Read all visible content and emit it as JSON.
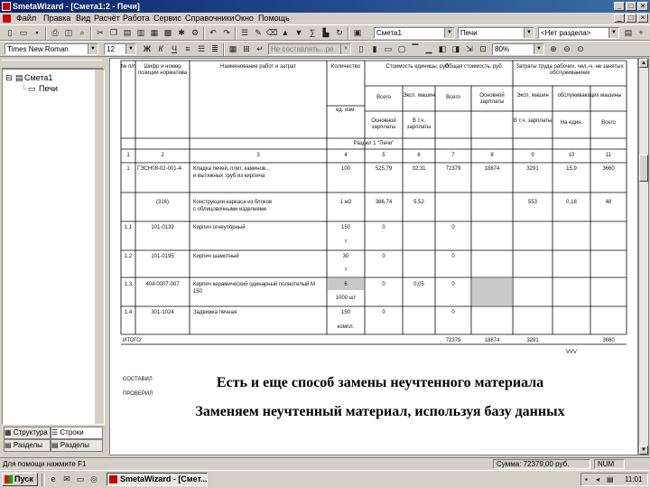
{
  "window": {
    "title": "SmetaWizard - [Смета1:2 - Печи]",
    "controls": [
      "_",
      "□",
      "×"
    ]
  },
  "menu": {
    "items": [
      "Файл",
      "Правка",
      "Вид",
      "Расчёт",
      "Работа",
      "Сервис",
      "Справочники",
      "Окно",
      "Помощь"
    ],
    "mdi_controls": [
      "_",
      "□",
      "×"
    ]
  },
  "toolbar1": {
    "estimate_combo": "Смета1",
    "section_combo": "Печи",
    "division_combo": "<Нет раздела>"
  },
  "toolbar2": {
    "font_combo": "Times New Roman",
    "size_combo": "12",
    "bold": "Ж",
    "italic": "К",
    "underline": "Ч",
    "style_combo": "Не составлять...ре",
    "zoom_combo": "80%"
  },
  "tree": {
    "root": "Смета1",
    "child": "Печи"
  },
  "panel_tabs": [
    "Структура",
    "Строки",
    "Разделы",
    "Разделы"
  ],
  "table": {
    "headers": {
      "num": "№ п/п",
      "code": "Шифр и номер позиции норматива",
      "name": "Наименование работ и затрат",
      "qty": "Количество",
      "unit_cost": "Стоимость единицы, руб.",
      "total_cost": "Общая стоимость, руб.",
      "labor": "Затраты труда рабочих, чел.-ч, не занятых обслуживанием",
      "unit": "ед. изм.",
      "all": "Всего",
      "exp_mach": "Эксп. машин",
      "base_salary": "Основной зарплаты",
      "salary": "Основной зарплаты",
      "incl_salary": "В т.ч. зарплаты",
      "serv_mach": "обслуживающих машины",
      "per_unit": "На един.",
      "total": "Всего",
      "section": "Раздел 1 \"Печи\"",
      "col_nums": [
        "1",
        "2",
        "3",
        "4",
        "5",
        "6",
        "7",
        "8",
        "9",
        "10",
        "11"
      ]
    },
    "rows": [
      {
        "num": "1",
        "code": "ГЭСН08-02-001-4",
        "name": "Кладка печей, плит, каминов...",
        "name2": "и вытяжных труб из кирпича",
        "qty": "100",
        "c5": "525,79",
        "c6": "32,31",
        "c7": "72379",
        "c8": "18874",
        "c9": "3291",
        "c10": "15,9",
        "c11": "3660"
      },
      {
        "num": "",
        "code": "(316)",
        "name": "Конструкции каркаса из блоков",
        "name2": "с облицовочными изделиями",
        "qty": "1 м3",
        "c5": "386,74",
        "c6": "5,52",
        "c7": "",
        "c8": "",
        "c9": "553",
        "c10": "0,18",
        "c11": "48"
      },
      {
        "num": "1.1",
        "code": "101-0139",
        "name": "Кирпич огнеупорный",
        "name2": "",
        "qty": "150",
        "qty2": "т",
        "c5": "0",
        "c6": "",
        "c7": "0",
        "c8": "",
        "c9": "",
        "c10": "",
        "c11": ""
      },
      {
        "num": "1.2",
        "code": "101-0195",
        "name": "Кирпич шамотный",
        "name2": "",
        "qty": "30",
        "qty2": "т",
        "c5": "0",
        "c6": "",
        "c7": "0",
        "c8": "",
        "c9": "",
        "c10": "",
        "c11": ""
      },
      {
        "num": "1.3",
        "code": "404-0007-007",
        "name": "Кирпич керамический одинарный полнотелый М",
        "name2": "150",
        "qty": "6",
        "qty2": "1000 шт",
        "c5": "0",
        "c6": "0,05",
        "c7": "0",
        "c8": "",
        "c9": "",
        "c10": "",
        "c11": ""
      },
      {
        "num": "1.4",
        "code": "301-1024",
        "name": "Задвижка печная",
        "name2": "",
        "qty": "150",
        "qty2": "компл.",
        "c5": "0",
        "c6": "",
        "c7": "0",
        "c8": "",
        "c9": "",
        "c10": "",
        "c11": ""
      }
    ],
    "total_row": {
      "label": "ИТОГО",
      "c7": "72379",
      "c8": "18874",
      "c9": "3291",
      "c11": "3660",
      "c9b": "VVV"
    },
    "footer": [
      "СОСТАВИЛ",
      "ПРОВЕРИЛ"
    ]
  },
  "overlay": {
    "line1": "Есть и еще способ замены неучтенного материала",
    "line2": "Заменяем неучтенный материал, используя базу данных"
  },
  "status": {
    "left": "Для помощи нажмите F1",
    "sum": "Сумма: 72379,00 руб.",
    "caps": "NUM"
  },
  "taskbar": {
    "start": "Пуск",
    "app": "SmetaWizard - [Смет...",
    "clock": "11:01"
  },
  "colors": {
    "title_bar": "#0a246a",
    "face": "#d4d0c8",
    "highlight_cell": "#c8c8c8"
  }
}
